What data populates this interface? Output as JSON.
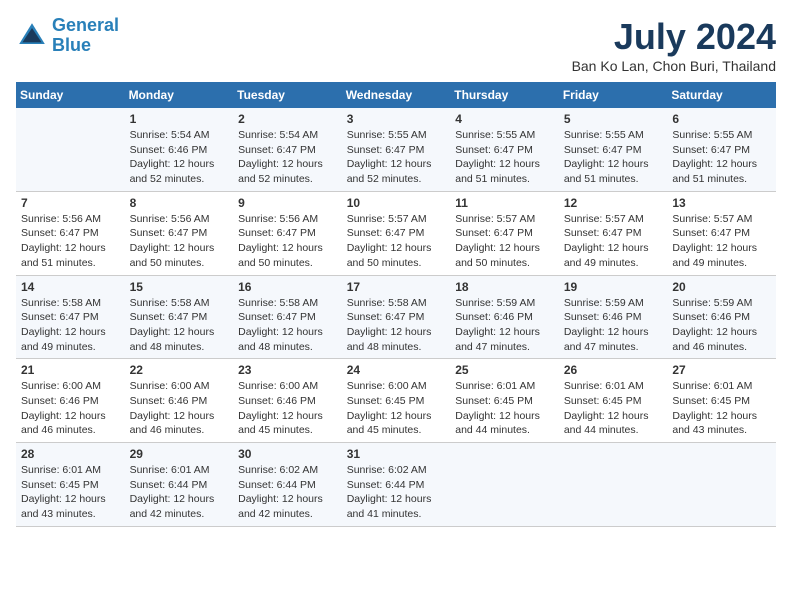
{
  "logo": {
    "line1": "General",
    "line2": "Blue"
  },
  "title": "July 2024",
  "subtitle": "Ban Ko Lan, Chon Buri, Thailand",
  "days_of_week": [
    "Sunday",
    "Monday",
    "Tuesday",
    "Wednesday",
    "Thursday",
    "Friday",
    "Saturday"
  ],
  "weeks": [
    [
      {
        "num": "",
        "sunrise": "",
        "sunset": "",
        "daylight": ""
      },
      {
        "num": "1",
        "sunrise": "Sunrise: 5:54 AM",
        "sunset": "Sunset: 6:46 PM",
        "daylight": "Daylight: 12 hours and 52 minutes."
      },
      {
        "num": "2",
        "sunrise": "Sunrise: 5:54 AM",
        "sunset": "Sunset: 6:47 PM",
        "daylight": "Daylight: 12 hours and 52 minutes."
      },
      {
        "num": "3",
        "sunrise": "Sunrise: 5:55 AM",
        "sunset": "Sunset: 6:47 PM",
        "daylight": "Daylight: 12 hours and 52 minutes."
      },
      {
        "num": "4",
        "sunrise": "Sunrise: 5:55 AM",
        "sunset": "Sunset: 6:47 PM",
        "daylight": "Daylight: 12 hours and 51 minutes."
      },
      {
        "num": "5",
        "sunrise": "Sunrise: 5:55 AM",
        "sunset": "Sunset: 6:47 PM",
        "daylight": "Daylight: 12 hours and 51 minutes."
      },
      {
        "num": "6",
        "sunrise": "Sunrise: 5:55 AM",
        "sunset": "Sunset: 6:47 PM",
        "daylight": "Daylight: 12 hours and 51 minutes."
      }
    ],
    [
      {
        "num": "7",
        "sunrise": "Sunrise: 5:56 AM",
        "sunset": "Sunset: 6:47 PM",
        "daylight": "Daylight: 12 hours and 51 minutes."
      },
      {
        "num": "8",
        "sunrise": "Sunrise: 5:56 AM",
        "sunset": "Sunset: 6:47 PM",
        "daylight": "Daylight: 12 hours and 50 minutes."
      },
      {
        "num": "9",
        "sunrise": "Sunrise: 5:56 AM",
        "sunset": "Sunset: 6:47 PM",
        "daylight": "Daylight: 12 hours and 50 minutes."
      },
      {
        "num": "10",
        "sunrise": "Sunrise: 5:57 AM",
        "sunset": "Sunset: 6:47 PM",
        "daylight": "Daylight: 12 hours and 50 minutes."
      },
      {
        "num": "11",
        "sunrise": "Sunrise: 5:57 AM",
        "sunset": "Sunset: 6:47 PM",
        "daylight": "Daylight: 12 hours and 50 minutes."
      },
      {
        "num": "12",
        "sunrise": "Sunrise: 5:57 AM",
        "sunset": "Sunset: 6:47 PM",
        "daylight": "Daylight: 12 hours and 49 minutes."
      },
      {
        "num": "13",
        "sunrise": "Sunrise: 5:57 AM",
        "sunset": "Sunset: 6:47 PM",
        "daylight": "Daylight: 12 hours and 49 minutes."
      }
    ],
    [
      {
        "num": "14",
        "sunrise": "Sunrise: 5:58 AM",
        "sunset": "Sunset: 6:47 PM",
        "daylight": "Daylight: 12 hours and 49 minutes."
      },
      {
        "num": "15",
        "sunrise": "Sunrise: 5:58 AM",
        "sunset": "Sunset: 6:47 PM",
        "daylight": "Daylight: 12 hours and 48 minutes."
      },
      {
        "num": "16",
        "sunrise": "Sunrise: 5:58 AM",
        "sunset": "Sunset: 6:47 PM",
        "daylight": "Daylight: 12 hours and 48 minutes."
      },
      {
        "num": "17",
        "sunrise": "Sunrise: 5:58 AM",
        "sunset": "Sunset: 6:47 PM",
        "daylight": "Daylight: 12 hours and 48 minutes."
      },
      {
        "num": "18",
        "sunrise": "Sunrise: 5:59 AM",
        "sunset": "Sunset: 6:46 PM",
        "daylight": "Daylight: 12 hours and 47 minutes."
      },
      {
        "num": "19",
        "sunrise": "Sunrise: 5:59 AM",
        "sunset": "Sunset: 6:46 PM",
        "daylight": "Daylight: 12 hours and 47 minutes."
      },
      {
        "num": "20",
        "sunrise": "Sunrise: 5:59 AM",
        "sunset": "Sunset: 6:46 PM",
        "daylight": "Daylight: 12 hours and 46 minutes."
      }
    ],
    [
      {
        "num": "21",
        "sunrise": "Sunrise: 6:00 AM",
        "sunset": "Sunset: 6:46 PM",
        "daylight": "Daylight: 12 hours and 46 minutes."
      },
      {
        "num": "22",
        "sunrise": "Sunrise: 6:00 AM",
        "sunset": "Sunset: 6:46 PM",
        "daylight": "Daylight: 12 hours and 46 minutes."
      },
      {
        "num": "23",
        "sunrise": "Sunrise: 6:00 AM",
        "sunset": "Sunset: 6:46 PM",
        "daylight": "Daylight: 12 hours and 45 minutes."
      },
      {
        "num": "24",
        "sunrise": "Sunrise: 6:00 AM",
        "sunset": "Sunset: 6:45 PM",
        "daylight": "Daylight: 12 hours and 45 minutes."
      },
      {
        "num": "25",
        "sunrise": "Sunrise: 6:01 AM",
        "sunset": "Sunset: 6:45 PM",
        "daylight": "Daylight: 12 hours and 44 minutes."
      },
      {
        "num": "26",
        "sunrise": "Sunrise: 6:01 AM",
        "sunset": "Sunset: 6:45 PM",
        "daylight": "Daylight: 12 hours and 44 minutes."
      },
      {
        "num": "27",
        "sunrise": "Sunrise: 6:01 AM",
        "sunset": "Sunset: 6:45 PM",
        "daylight": "Daylight: 12 hours and 43 minutes."
      }
    ],
    [
      {
        "num": "28",
        "sunrise": "Sunrise: 6:01 AM",
        "sunset": "Sunset: 6:45 PM",
        "daylight": "Daylight: 12 hours and 43 minutes."
      },
      {
        "num": "29",
        "sunrise": "Sunrise: 6:01 AM",
        "sunset": "Sunset: 6:44 PM",
        "daylight": "Daylight: 12 hours and 42 minutes."
      },
      {
        "num": "30",
        "sunrise": "Sunrise: 6:02 AM",
        "sunset": "Sunset: 6:44 PM",
        "daylight": "Daylight: 12 hours and 42 minutes."
      },
      {
        "num": "31",
        "sunrise": "Sunrise: 6:02 AM",
        "sunset": "Sunset: 6:44 PM",
        "daylight": "Daylight: 12 hours and 41 minutes."
      },
      {
        "num": "",
        "sunrise": "",
        "sunset": "",
        "daylight": ""
      },
      {
        "num": "",
        "sunrise": "",
        "sunset": "",
        "daylight": ""
      },
      {
        "num": "",
        "sunrise": "",
        "sunset": "",
        "daylight": ""
      }
    ]
  ]
}
